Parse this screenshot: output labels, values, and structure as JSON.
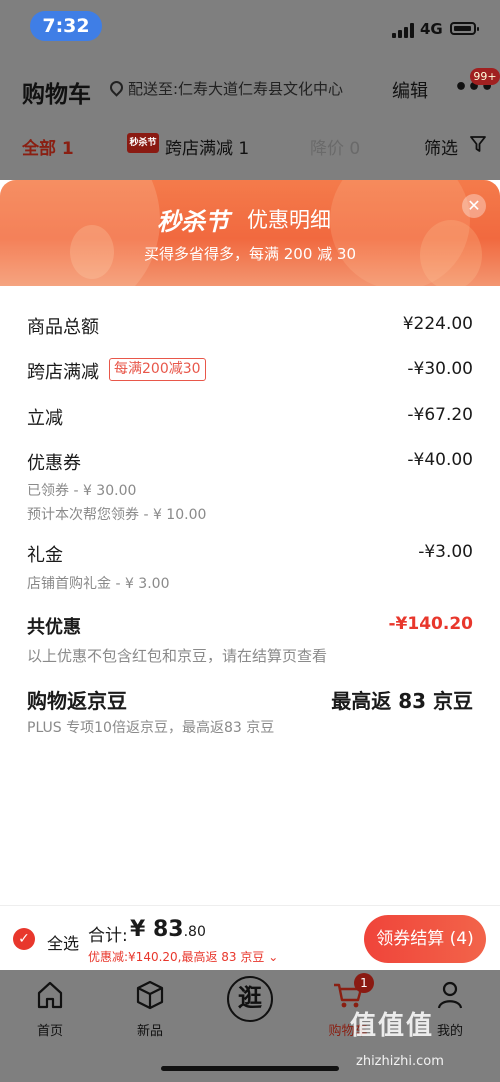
{
  "status_bar": {
    "time": "7:32",
    "network": "4G"
  },
  "header": {
    "title": "购物车",
    "address": "配送至:仁寿大道仁寿县文化中心",
    "edit": "编辑",
    "more_badge": "99+",
    "tabs": {
      "all": "全部 1",
      "seckill_chip": "秒杀节",
      "promo": "跨店满减 1",
      "price_drop": "降价 0",
      "filter": "筛选"
    }
  },
  "sheet": {
    "banner_logo": "秒杀节",
    "banner_title": "优惠明细",
    "banner_subtitle": "买得多省得多，每满 200 减 30",
    "rows": {
      "goods_total": {
        "label": "商品总额",
        "value": "¥224.00"
      },
      "cross_store": {
        "label": "跨店满减",
        "tag": "每满200减30",
        "value": "-¥30.00"
      },
      "instant": {
        "label": "立减",
        "value": "-¥67.20"
      },
      "coupon": {
        "label": "优惠券",
        "value": "-¥40.00",
        "note1": "已领券 - ¥ 30.00",
        "note2": "预计本次帮您领券 - ¥ 10.00"
      },
      "gift": {
        "label": "礼金",
        "value": "-¥3.00",
        "note": "店铺首购礼金 - ¥ 3.00"
      },
      "total_discount": {
        "label": "共优惠",
        "value": "-¥140.20",
        "note": "以上优惠不包含红包和京豆，请在结算页查看"
      },
      "beans": {
        "label": "购物返京豆",
        "value": "最高返 83 京豆",
        "note": "PLUS 专项10倍返京豆，最高返83 京豆"
      }
    }
  },
  "checkout": {
    "select_all": "全选",
    "sum_label": "合计:",
    "sum_main": "¥ 83",
    "sum_decimal": ".80",
    "discount_line": "优惠减:¥140.20,最高返 83 京豆 ⌄",
    "pay_button": "领券结算 (4)"
  },
  "tabbar": {
    "home": "首页",
    "new": "新品",
    "stroll": "逛",
    "cart": "购物车",
    "cart_count": "1",
    "me": "我的"
  },
  "watermark": {
    "text": "值值值",
    "url": "zhizhizhi.com"
  },
  "colors": {
    "accent_red": "#e8372c",
    "banner_orange": "#f1693f",
    "dim_overlay": "#7f7f7f"
  }
}
